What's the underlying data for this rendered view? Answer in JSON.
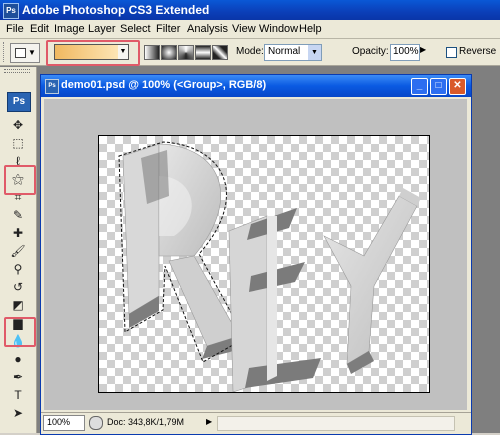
{
  "app": {
    "title": "Adobe Photoshop CS3 Extended",
    "logo": "Ps"
  },
  "menu": [
    "File",
    "Edit",
    "Image",
    "Layer",
    "Select",
    "Filter",
    "Analysis",
    "View",
    "Window",
    "Help"
  ],
  "options": {
    "mode_label": "Mode:",
    "mode_value": "Normal",
    "opacity_label": "Opacity:",
    "opacity_value": "100%",
    "reverse_label": "Reverse",
    "gradient_colors": [
      "#f0b860",
      "#fde6b6"
    ]
  },
  "toolbox": {
    "badge": "Ps",
    "tools": [
      {
        "name": "move-tool-icon",
        "glyph": "✥"
      },
      {
        "name": "marquee-tool-icon",
        "glyph": "⬚"
      },
      {
        "name": "lasso-tool-icon",
        "glyph": "ℓ"
      },
      {
        "name": "magic-wand-tool-icon",
        "glyph": "⚝"
      },
      {
        "name": "crop-tool-icon",
        "glyph": "⌗"
      },
      {
        "name": "eyedropper-tool-icon",
        "glyph": "✎"
      },
      {
        "name": "healing-brush-tool-icon",
        "glyph": "✚"
      },
      {
        "name": "brush-tool-icon",
        "glyph": "🖌"
      },
      {
        "name": "clone-stamp-tool-icon",
        "glyph": "⚲"
      },
      {
        "name": "history-brush-tool-icon",
        "glyph": "↺"
      },
      {
        "name": "eraser-tool-icon",
        "glyph": "◩"
      },
      {
        "name": "gradient-tool-icon",
        "glyph": "▆"
      },
      {
        "name": "blur-tool-icon",
        "glyph": "💧"
      },
      {
        "name": "dodge-tool-icon",
        "glyph": "●"
      },
      {
        "name": "pen-tool-icon",
        "glyph": "✒"
      },
      {
        "name": "type-tool-icon",
        "glyph": "T"
      },
      {
        "name": "path-selection-tool-icon",
        "glyph": "➤"
      }
    ]
  },
  "document": {
    "title": "demo01.psd @ 100% (<Group>, RGB/8)",
    "zoom": "100%",
    "doc_info": "Doc: 343,8K/1,79M",
    "artwork_text": "REY"
  }
}
